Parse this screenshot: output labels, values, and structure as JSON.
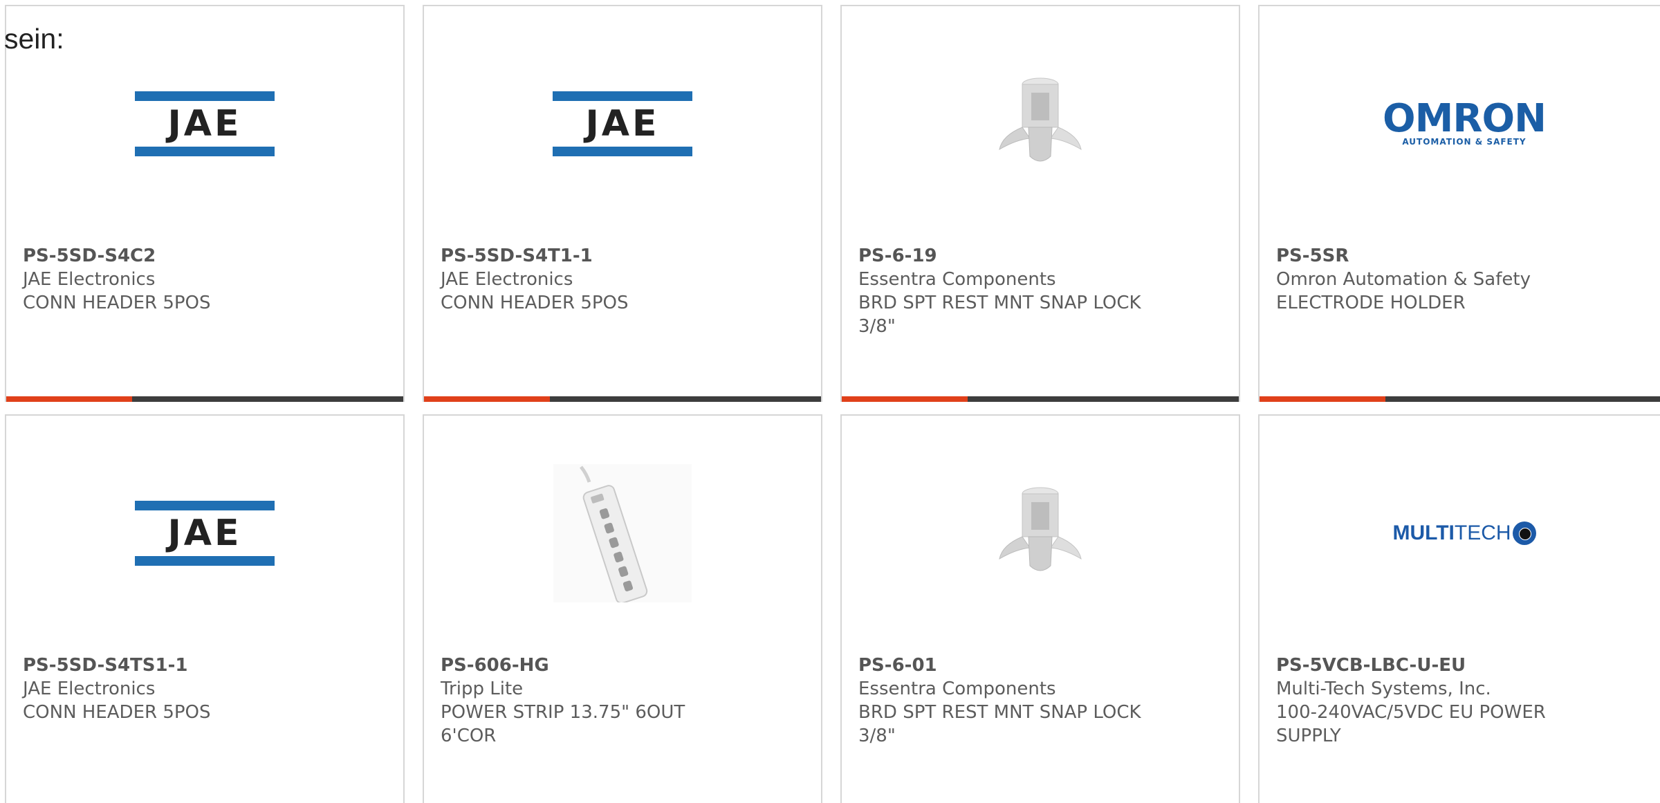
{
  "intro_text": "sein:",
  "colors": {
    "accent": "#e0401a",
    "bar": "#3d3d3d",
    "jae_blue": "#1f6fb3",
    "omron_blue": "#1b5ea6",
    "multitech_blue": "#1c5aa8"
  },
  "products": [
    {
      "part_number": "PS-5SD-S4C2",
      "manufacturer": "JAE Electronics",
      "description": "CONN HEADER 5POS",
      "image": "jae-logo",
      "logo_text": "JAE"
    },
    {
      "part_number": "PS-5SD-S4T1-1",
      "manufacturer": "JAE Electronics",
      "description": "CONN HEADER 5POS",
      "image": "jae-logo",
      "logo_text": "JAE"
    },
    {
      "part_number": "PS-6-19",
      "manufacturer": "Essentra Components",
      "description": "BRD SPT REST MNT SNAP LOCK 3/8\"",
      "image": "snap-lock-support-photo"
    },
    {
      "part_number": "PS-5SR",
      "manufacturer": "Omron Automation & Safety",
      "description": "ELECTRODE HOLDER",
      "image": "omron-logo",
      "logo_text": "OMRON",
      "logo_subtext": "AUTOMATION & SAFETY"
    },
    {
      "part_number": "PS-5SD-S4TS1-1",
      "manufacturer": "JAE Electronics",
      "description": "CONN HEADER 5POS",
      "image": "jae-logo",
      "logo_text": "JAE"
    },
    {
      "part_number": "PS-606-HG",
      "manufacturer": "Tripp Lite",
      "description": "POWER STRIP 13.75\" 6OUT 6'COR",
      "image": "power-strip-photo"
    },
    {
      "part_number": "PS-6-01",
      "manufacturer": "Essentra Components",
      "description": "BRD SPT REST MNT SNAP LOCK 3/8\"",
      "image": "snap-lock-support-photo"
    },
    {
      "part_number": "PS-5VCB-LBC-U-EU",
      "manufacturer": "Multi-Tech Systems, Inc.",
      "description": "100-240VAC/5VDC EU POWER SUPPLY",
      "image": "multitech-logo",
      "logo_text_bold": "MULTI",
      "logo_text_regular": "TECH"
    }
  ]
}
